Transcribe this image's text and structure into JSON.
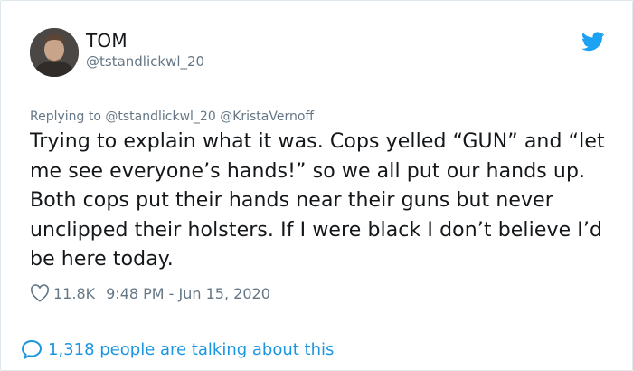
{
  "author": {
    "name": "TOM",
    "handle": "@tstandlickwl_20"
  },
  "reply": {
    "prefix": "Replying to",
    "mentions": "@tstandlickwl_20 @KristaVernoff"
  },
  "tweet": {
    "text": "Trying to explain what it was. Cops yelled “GUN” and “let me see everyone’s hands!” so we all put our hands up. Both cops put their hands near their guns but never unclipped their holsters. If I were black I don’t believe I’d be here today."
  },
  "meta": {
    "likes": "11.8K",
    "timestamp": "9:48 PM - Jun 15, 2020"
  },
  "footer": {
    "talking": "1,318 people are talking about this"
  },
  "icons": {
    "brand": "twitter-bird-icon",
    "like": "heart-icon",
    "reply": "speech-bubble-icon"
  },
  "colors": {
    "brand": "#1da1f2",
    "link": "#1b95e0",
    "muted": "#657786",
    "text": "#14171a"
  }
}
